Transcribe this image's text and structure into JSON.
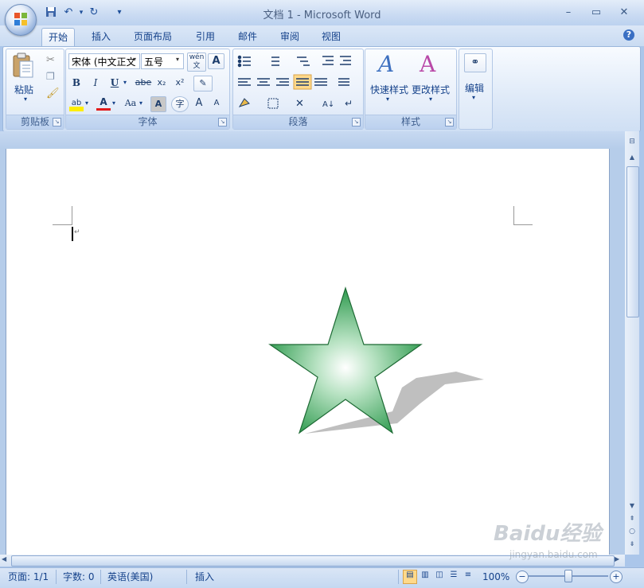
{
  "window": {
    "title": "文档 1 - Microsoft Word",
    "controls": {
      "minimize": "–",
      "maximize": "▭",
      "close": "✕"
    }
  },
  "quick_access": {
    "save": "save-icon",
    "undo": "undo-icon",
    "redo": "redo-icon",
    "customize": "▾"
  },
  "tabs": [
    {
      "label": "开始",
      "active": true
    },
    {
      "label": "插入"
    },
    {
      "label": "页面布局"
    },
    {
      "label": "引用"
    },
    {
      "label": "邮件"
    },
    {
      "label": "审阅"
    },
    {
      "label": "视图"
    }
  ],
  "help": "?",
  "ribbon": {
    "clipboard": {
      "label": "剪贴板",
      "paste": "粘贴"
    },
    "font": {
      "label": "字体",
      "font_name": "宋体 (中文正文",
      "font_size": "五号",
      "bold": "B",
      "italic": "I",
      "underline": "U",
      "strike": "abe",
      "subscript": "x₂",
      "superscript": "x²",
      "highlight": "ab",
      "font_color": "A",
      "change_case": "Aa",
      "char_shading": "A",
      "enclose": "字",
      "grow": "A",
      "shrink": "A",
      "phonetic": "wén 文",
      "char_border": "A"
    },
    "paragraph": {
      "label": "段落"
    },
    "styles": {
      "label": "样式",
      "quick_styles": "快速样式",
      "change_styles": "更改样式"
    },
    "editing": {
      "label": "编辑"
    }
  },
  "document": {
    "shape": "star-shape",
    "cursor": "|"
  },
  "status": {
    "page": "页面: 1/1",
    "words": "字数: 0",
    "language": "英语(美国)",
    "mode": "插入",
    "zoom": "100%"
  },
  "colors": {
    "accent": "#15428b",
    "star_green": "#2e9a4e"
  },
  "watermark": {
    "logo": "Baidu经验",
    "url": "jingyan.baidu.com"
  }
}
